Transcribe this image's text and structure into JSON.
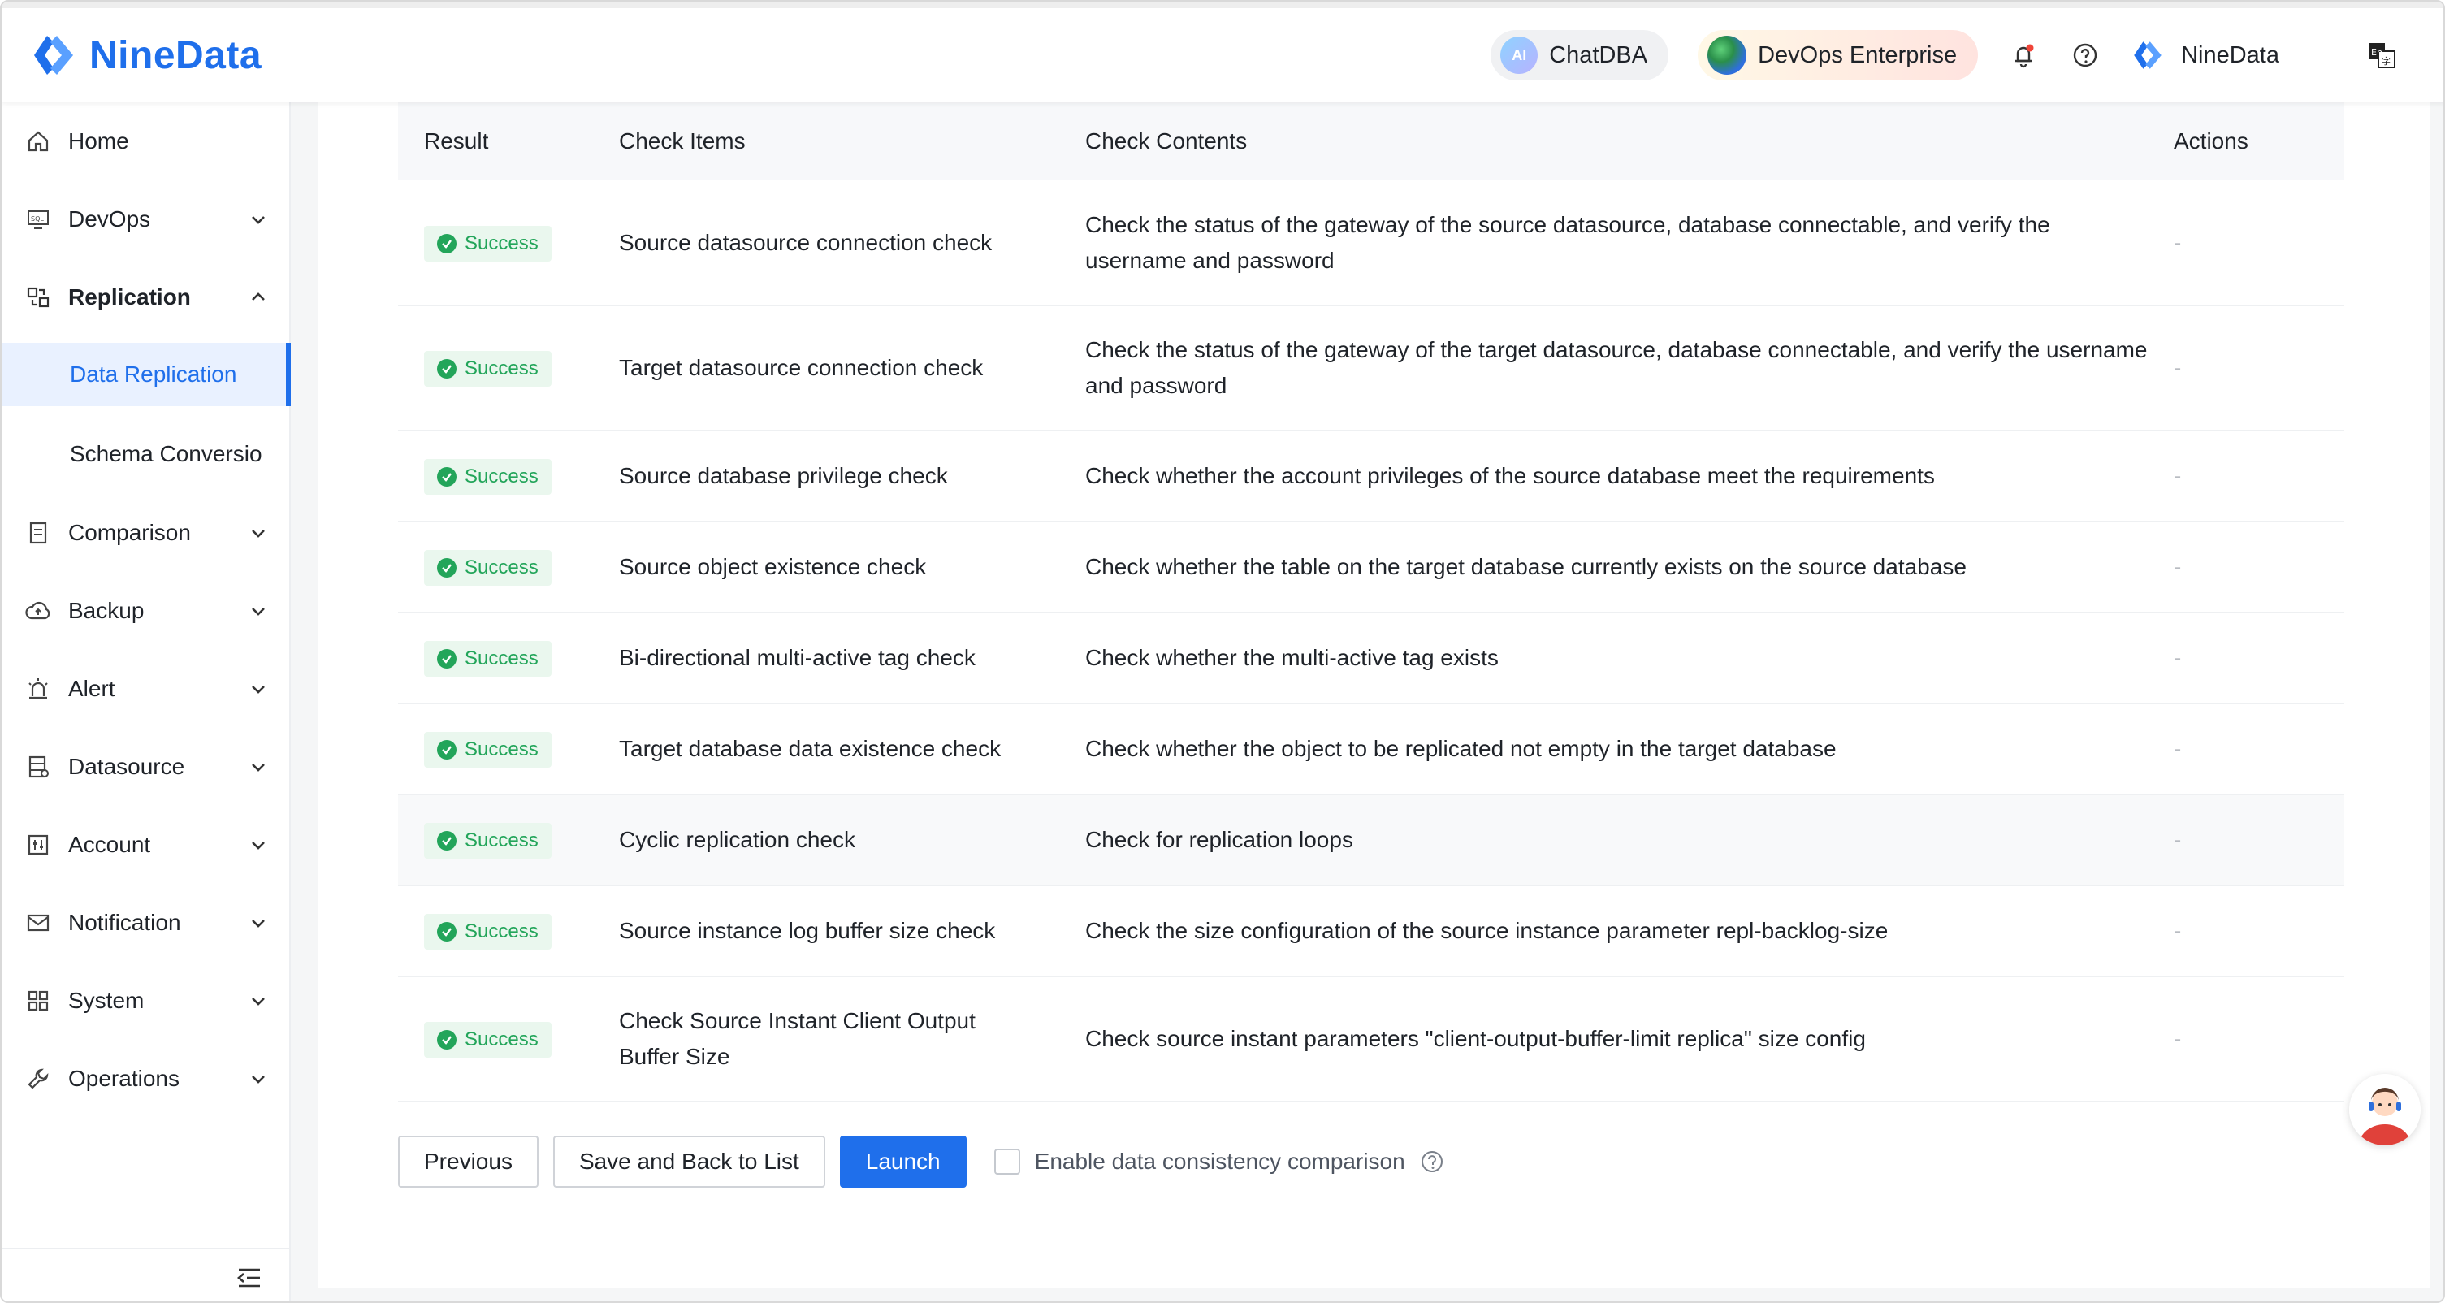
{
  "brand": {
    "name": "NineData",
    "color": "#1f6feb"
  },
  "header": {
    "chatdba_label": "ChatDBA",
    "chatdba_badge": "AI",
    "devops_label": "DevOps Enterprise",
    "user_name": "NineData",
    "icons": [
      "bell-icon",
      "help-icon",
      "ninedata-logo-icon",
      "language-icon"
    ]
  },
  "sidebar": {
    "items": [
      {
        "label": "Home",
        "icon": "home-icon"
      },
      {
        "label": "DevOps",
        "icon": "sql-icon"
      },
      {
        "label": "Replication",
        "icon": "replication-icon"
      },
      {
        "label": "Comparison",
        "icon": "comparison-icon"
      },
      {
        "label": "Backup",
        "icon": "backup-icon"
      },
      {
        "label": "Alert",
        "icon": "alert-icon"
      },
      {
        "label": "Datasource",
        "icon": "datasource-icon"
      },
      {
        "label": "Account",
        "icon": "account-icon"
      },
      {
        "label": "Notification",
        "icon": "mail-icon"
      },
      {
        "label": "System",
        "icon": "grid-icon"
      },
      {
        "label": "Operations",
        "icon": "wrench-icon"
      }
    ],
    "sub_items": [
      {
        "label": "Data Replication",
        "active": true
      },
      {
        "label": "Schema Conversio",
        "active": false
      }
    ]
  },
  "table": {
    "headers": [
      "Result",
      "Check Items",
      "Check Contents",
      "Actions"
    ],
    "rows": [
      {
        "result": "Success",
        "item": "Source datasource connection check",
        "content": "Check the status of the gateway of the source datasource, database connectable, and verify the username and password",
        "action": "-"
      },
      {
        "result": "Success",
        "item": "Target datasource connection check",
        "content": "Check the status of the gateway of the target datasource, database connectable, and verify the username and password",
        "action": "-"
      },
      {
        "result": "Success",
        "item": "Source database privilege check",
        "content": "Check whether the account privileges of the source database meet the requirements",
        "action": "-"
      },
      {
        "result": "Success",
        "item": "Source object existence check",
        "content": "Check whether the table on the target database currently exists on the source database",
        "action": "-"
      },
      {
        "result": "Success",
        "item": "Bi-directional multi-active tag check",
        "content": "Check whether the multi-active tag exists",
        "action": "-"
      },
      {
        "result": "Success",
        "item": "Target database data existence check",
        "content": "Check whether the object to be replicated not empty in the target database",
        "action": "-"
      },
      {
        "result": "Success",
        "item": "Cyclic replication check",
        "content": "Check for replication loops",
        "action": "-"
      },
      {
        "result": "Success",
        "item": "Source instance log buffer size check",
        "content": "Check the size configuration of the source instance parameter repl-backlog-size",
        "action": "-"
      },
      {
        "result": "Success",
        "item": "Check Source Instant Client Output Buffer Size",
        "content": "Check source instant parameters \"client-output-buffer-limit replica\" size config",
        "action": "-"
      }
    ]
  },
  "actions": {
    "previous": "Previous",
    "save_back": "Save and Back to List",
    "launch": "Launch",
    "consistency_label": "Enable data consistency comparison"
  },
  "colors": {
    "success": "#23a55a",
    "success_bg": "#eaf7ee",
    "primary": "#1f6feb"
  }
}
